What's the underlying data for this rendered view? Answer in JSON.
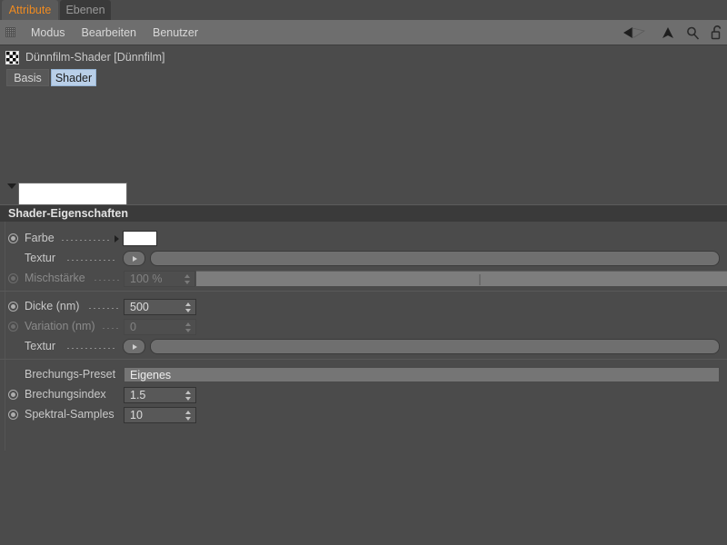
{
  "window": {
    "tabs": [
      {
        "label": "Attribute",
        "active": true
      },
      {
        "label": "Ebenen",
        "active": false
      }
    ],
    "accent_active_tab_text": "#ef8b21",
    "background": "#4b4b4b"
  },
  "menubar": {
    "grip_icon": "grip-dots-icon",
    "items": [
      "Modus",
      "Bearbeiten",
      "Benutzer"
    ],
    "icons": [
      "back-arrow-icon",
      "up-arrow-icon",
      "search-icon",
      "lock-open-icon"
    ]
  },
  "object": {
    "icon": "checkerboard-shader-icon",
    "title": "Dünnfilm-Shader [Dünnfilm]"
  },
  "subtabs": [
    {
      "label": "Basis",
      "active": false
    },
    {
      "label": "Shader",
      "active": true
    }
  ],
  "preview": {
    "collapse_icon": "triangle-down-icon",
    "swatch_color": "#ffffff"
  },
  "section": {
    "title": "Shader-Eigenschaften"
  },
  "properties": [
    {
      "name": "farbe",
      "label": "Farbe",
      "widget": "color",
      "value": "#ffffff",
      "enabled": true,
      "has_radio": true
    },
    {
      "name": "textur-farbe",
      "label": "Textur",
      "widget": "texture",
      "value": "",
      "enabled": true,
      "has_radio": false
    },
    {
      "name": "mischstaerke",
      "label": "Mischstärke",
      "widget": "number-slider",
      "value": "100 %",
      "enabled": false,
      "has_radio": true
    },
    {
      "name": "dicke-nm",
      "label": "Dicke (nm)",
      "widget": "number",
      "value": "500",
      "enabled": true,
      "has_radio": true
    },
    {
      "name": "variation-nm",
      "label": "Variation (nm)",
      "widget": "number",
      "value": "0",
      "enabled": false,
      "has_radio": true
    },
    {
      "name": "textur-dicke",
      "label": "Textur",
      "widget": "texture",
      "value": "",
      "enabled": true,
      "has_radio": false
    },
    {
      "name": "brechungs-preset",
      "label": "Brechungs-Preset",
      "widget": "combo",
      "value": "Eigenes",
      "enabled": true,
      "has_radio": false
    },
    {
      "name": "brechungsindex",
      "label": "Brechungsindex",
      "widget": "number",
      "value": "1.5",
      "enabled": true,
      "has_radio": true
    },
    {
      "name": "spektral-samples",
      "label": "Spektral-Samples",
      "widget": "number",
      "value": "10",
      "enabled": true,
      "has_radio": true
    }
  ]
}
